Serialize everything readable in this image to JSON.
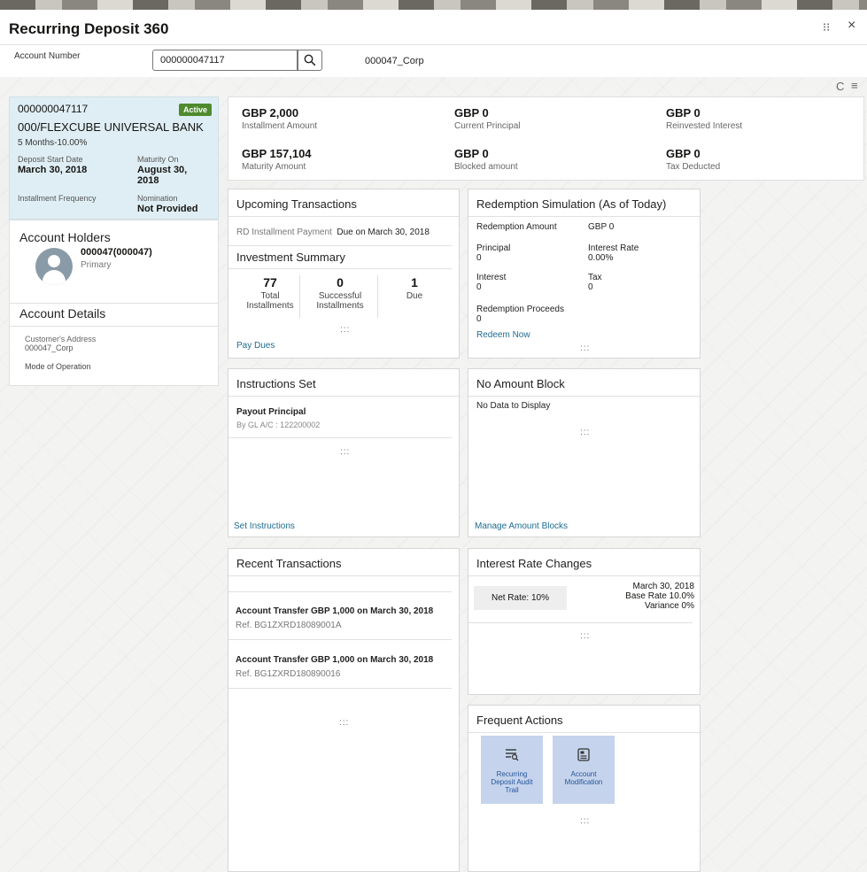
{
  "header": {
    "title": "Recurring Deposit 360",
    "maximize_icon": "⁝⁝",
    "close_icon": "×"
  },
  "account_bar": {
    "label": "Account Number",
    "value": "000000047117",
    "customer": "000047_Corp"
  },
  "toolbar": {
    "refresh_icon": "C",
    "menu_icon": "≡"
  },
  "account_card": {
    "number": "000000047117",
    "status": "Active",
    "bank": "000/FLEXCUBE UNIVERSAL BANK",
    "tenor": "5 Months-10.00%",
    "start_label": "Deposit Start Date",
    "start_value": "March 30, 2018",
    "maturity_label": "Maturity On",
    "maturity_value": "August 30, 2018",
    "freq_label": "Installment Frequency",
    "nomination_label": "Nomination",
    "nomination_value": "Not Provided"
  },
  "holders": {
    "title": "Account Holders",
    "name": "000047(000047)",
    "role": "Primary"
  },
  "details": {
    "title": "Account Details",
    "address_label": "Customer's Address",
    "address_value": "000047_Corp",
    "mode_label": "Mode of Operation"
  },
  "summary": [
    {
      "value": "GBP 2,000",
      "label": "Installment Amount"
    },
    {
      "value": "GBP 0",
      "label": "Current Principal"
    },
    {
      "value": "GBP 0",
      "label": "Reinvested Interest"
    },
    {
      "value": "GBP 157,104",
      "label": "Maturity Amount"
    },
    {
      "value": "GBP 0",
      "label": "Blocked amount"
    },
    {
      "value": "GBP 0",
      "label": "Tax Deducted"
    }
  ],
  "upcoming": {
    "title": "Upcoming Transactions",
    "item": "RD Installment Payment",
    "due": "Due on March 30, 2018",
    "inv_title": "Investment Summary",
    "total": "77",
    "total_label1": "Total",
    "total_label2": "Installments",
    "succ": "0",
    "succ_label1": "Successful",
    "succ_label2": "Installments",
    "due_count": "1",
    "due_label": "Due",
    "link": "Pay Dues"
  },
  "redemption": {
    "title": "Redemption Simulation (As of Today)",
    "amount_label": "Redemption Amount",
    "amount_value": "GBP 0",
    "principal_label": "Principal",
    "principal_value": "0",
    "rate_label": "Interest Rate",
    "rate_value": "0.00%",
    "interest_label": "Interest",
    "interest_value": "0",
    "tax_label": "Tax",
    "tax_value": "0",
    "proceeds_label": "Redemption Proceeds",
    "proceeds_value": "0",
    "link": "Redeem Now"
  },
  "instructions": {
    "title": "Instructions Set",
    "item": "Payout Principal",
    "sub": "By GL A/C : 122200002",
    "link": "Set Instructions"
  },
  "amount_block": {
    "title": "No Amount Block",
    "empty": "No Data to Display",
    "link": "Manage Amount Blocks"
  },
  "recent": {
    "title": "Recent Transactions",
    "items": [
      {
        "text": "Account Transfer GBP 1,000 on March 30, 2018",
        "ref": "Ref. BG1ZXRD18089001A"
      },
      {
        "text": "Account Transfer GBP 1,000 on March 30, 2018",
        "ref": "Ref. BG1ZXRD180890016"
      }
    ]
  },
  "interest_changes": {
    "title": "Interest Rate Changes",
    "net": "Net Rate: 10%",
    "date": "March 30, 2018",
    "base": "Base Rate 10.0%",
    "variance": "Variance 0%"
  },
  "frequent": {
    "title": "Frequent Actions",
    "actions": [
      {
        "icon": "audit-trail-icon",
        "line1": "Recurring",
        "line2": "Deposit Audit",
        "line3": "Trail"
      },
      {
        "icon": "account-modification-icon",
        "line1": "Account",
        "line2": "Modification",
        "line3": ""
      }
    ]
  },
  "more_icon": ":::"
}
